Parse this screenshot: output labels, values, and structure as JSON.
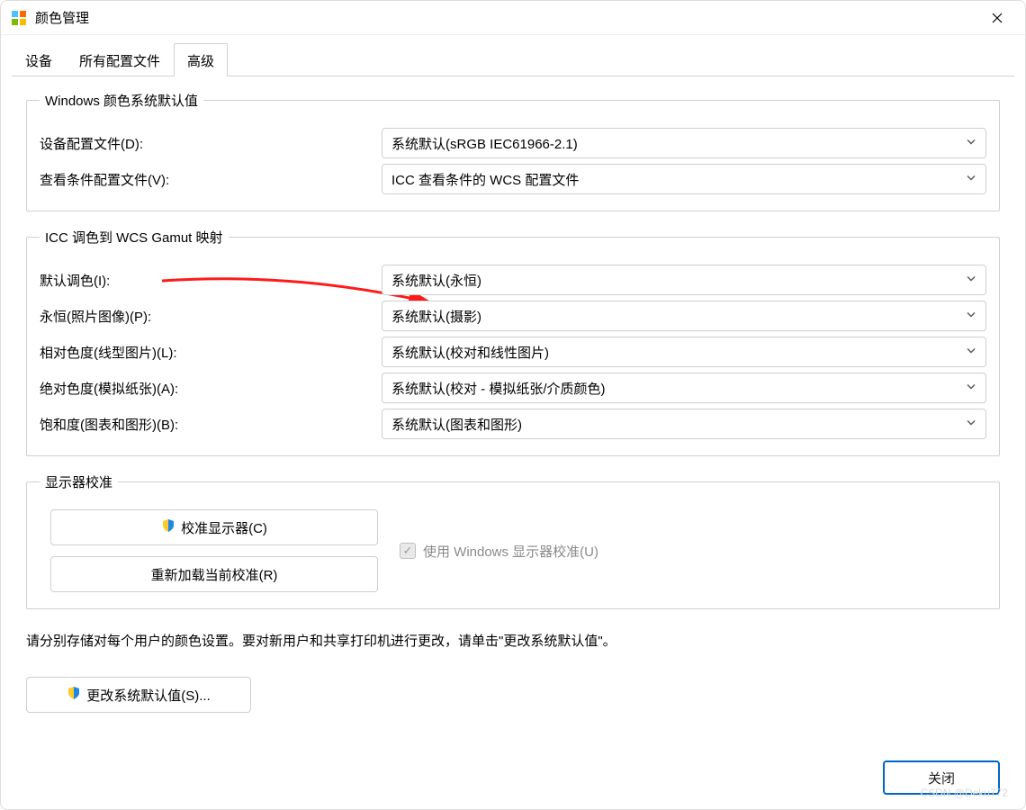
{
  "title": "颜色管理",
  "tabs": {
    "devices": "设备",
    "all_profiles": "所有配置文件",
    "advanced": "高级"
  },
  "group1": {
    "legend": "Windows 颜色系统默认值",
    "device_profile_label": "设备配置文件(D):",
    "device_profile_value": "系统默认(sRGB IEC61966-2.1)",
    "viewing_cond_label": "查看条件配置文件(V):",
    "viewing_cond_value": "ICC 查看条件的 WCS 配置文件"
  },
  "group2": {
    "legend": "ICC 调色到 WCS Gamut 映射",
    "default_intent_label": "默认调色(I):",
    "default_intent_value": "系统默认(永恒)",
    "perceptual_label": "永恒(照片图像)(P):",
    "perceptual_value": "系统默认(摄影)",
    "relcol_label": "相对色度(线型图片)(L):",
    "relcol_value": "系统默认(校对和线性图片)",
    "abscol_label": "绝对色度(模拟纸张)(A):",
    "abscol_value": "系统默认(校对 - 模拟纸张/介质颜色)",
    "sat_label": "饱和度(图表和图形)(B):",
    "sat_value": "系统默认(图表和图形)"
  },
  "group3": {
    "legend": "显示器校准",
    "calibrate_btn": "校准显示器(C)",
    "reload_btn": "重新加载当前校准(R)",
    "use_win_calib": "使用 Windows 显示器校准(U)"
  },
  "note": "请分别存储对每个用户的颜色设置。要对新用户和共享打印机进行更改，请单击\"更改系统默认值\"。",
  "change_defaults_btn": "更改系统默认值(S)...",
  "close_btn": "关闭",
  "watermark": "CSDN @Deku772"
}
